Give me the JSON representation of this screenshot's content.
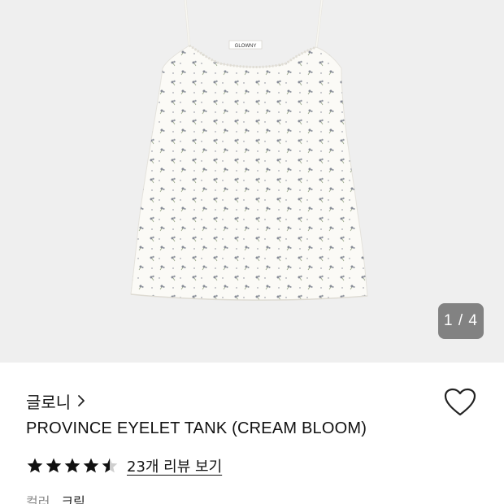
{
  "gallery": {
    "current_page": "1",
    "total_pages": "4",
    "page_indicator": "1 / 4",
    "image_label_text": "GLOWNY",
    "background_color": "#efefef",
    "garment_color": "#fbfaf6",
    "print_color": "#7a7f8c"
  },
  "product": {
    "brand": "글로니",
    "title": "PROVINCE EYELET TANK (CREAM BLOOM)",
    "rating": 4.5,
    "review_link": "23개 리뷰 보기",
    "option_label": "컬러",
    "option_value": "크림"
  },
  "icons": {
    "brand_chevron": "chevron-right-icon",
    "wishlist": "heart-outline-icon",
    "star": "star-icon"
  }
}
